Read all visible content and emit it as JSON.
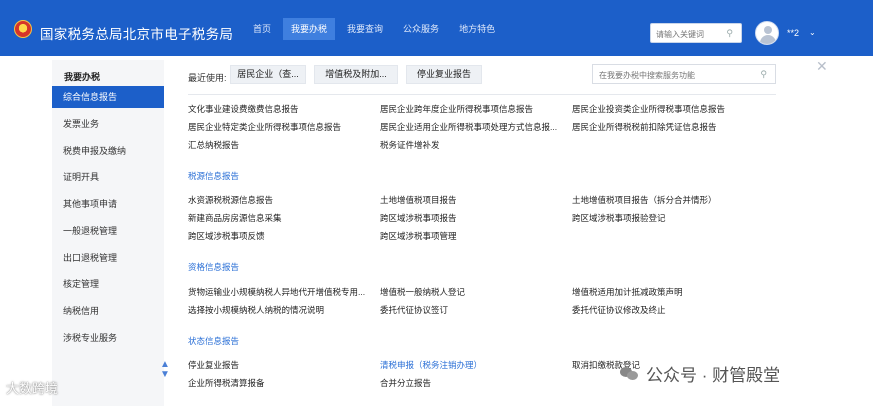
{
  "header": {
    "title": "国家税务总局北京市电子税务局",
    "nav": [
      {
        "label": "首页",
        "active": false
      },
      {
        "label": "我要办税",
        "active": true
      },
      {
        "label": "我要查询",
        "active": false
      },
      {
        "label": "公众服务",
        "active": false
      },
      {
        "label": "地方特色",
        "active": false
      }
    ],
    "search_placeholder": "请输入关键词",
    "user_name": "**2",
    "brand_color": "#1c5fc9"
  },
  "sidebar": {
    "title": "我要办税",
    "items": [
      {
        "label": "综合信息报告",
        "active": true
      },
      {
        "label": "发票业务"
      },
      {
        "label": "税费申报及缴纳"
      },
      {
        "label": "证明开具"
      },
      {
        "label": "其他事项申请"
      },
      {
        "label": "一般退税管理"
      },
      {
        "label": "出口退税管理"
      },
      {
        "label": "核定管理"
      },
      {
        "label": "纳税信用"
      },
      {
        "label": "涉税专业服务"
      }
    ]
  },
  "main": {
    "recent_label": "最近使用:",
    "recent": [
      "居民企业（查...",
      "增值税及附加...",
      "停业复业报告"
    ],
    "search_placeholder": "在我要办税中搜索服务功能",
    "groups": {
      "g0": [
        "文化事业建设费缴费信息报告",
        "居民企业跨年度企业所得税事项信息报告",
        "居民企业投资类企业所得税事项信息报告",
        "居民企业特定类企业所得税事项信息报告",
        "居民企业适用企业所得税事项处理方式信息报...",
        "居民企业所得税税前扣除凭证信息报告",
        "汇总纳税报告",
        "税务证件增补发"
      ],
      "s1": "税源信息报告",
      "g1": [
        "水资源税税源信息报告",
        "土地增值税项目报告",
        "土地增值税项目报告（拆分合并情形）",
        "新建商品房房源信息采集",
        "跨区域涉税事项报告",
        "跨区域涉税事项报验登记",
        "跨区域涉税事项反馈",
        "跨区域涉税事项管理"
      ],
      "s2": "资格信息报告",
      "g2": [
        "货物运输业小规模纳税人异地代开增值税专用...",
        "增值税一般纳税人登记",
        "增值税适用加计抵减政策声明",
        "选择按小规模纳税人纳税的情况说明",
        "委托代征协议签订",
        "委托代征协议修改及终止"
      ],
      "s3": "状态信息报告",
      "g3": [
        "停业复业报告",
        "清税申报（税务注销办理）",
        "取消扣缴税款登记",
        "企业所得税清算报备",
        "合并分立报告"
      ]
    }
  },
  "watermarks": {
    "left": "大数跨境",
    "right": "公众号 · 财管殿堂"
  }
}
